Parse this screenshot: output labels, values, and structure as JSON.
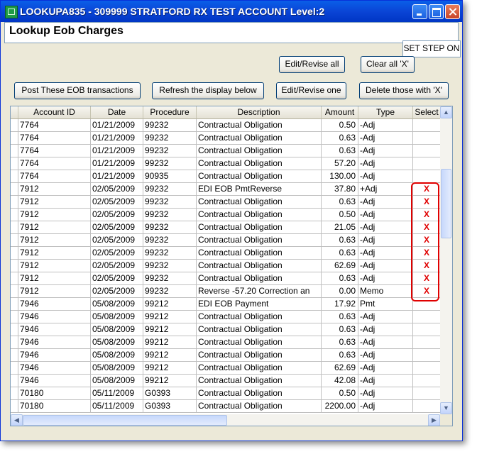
{
  "window": {
    "title": "LOOKUPA835  -  309999 STRATFORD RX TEST ACCOUNT Level:2"
  },
  "header": {
    "title": "Lookup Eob Charges"
  },
  "buttons": {
    "set_step_on": "SET STEP ON",
    "edit_revise_all": "Edit/Revise all",
    "clear_all_x": "Clear all 'X'",
    "post_eob": "Post These EOB transactions",
    "refresh": "Refresh the display below",
    "edit_revise_one": "Edit/Revise one",
    "delete_x": "Delete those with 'X'"
  },
  "table": {
    "columns": [
      "Account ID",
      "Date",
      "Procedure",
      "Description",
      "Amount",
      "Type",
      "Select"
    ],
    "rows": [
      [
        "7764",
        "01/21/2009",
        "99232",
        "Contractual Obligation",
        "0.50",
        "-Adj",
        ""
      ],
      [
        "7764",
        "01/21/2009",
        "99232",
        "Contractual Obligation",
        "0.63",
        "-Adj",
        ""
      ],
      [
        "7764",
        "01/21/2009",
        "99232",
        "Contractual Obligation",
        "0.63",
        "-Adj",
        ""
      ],
      [
        "7764",
        "01/21/2009",
        "99232",
        "Contractual Obligation",
        "57.20",
        "-Adj",
        ""
      ],
      [
        "7764",
        "01/21/2009",
        "90935",
        "Contractual Obligation",
        "130.00",
        "-Adj",
        ""
      ],
      [
        "7912",
        "02/05/2009",
        "99232",
        "EDI EOB PmtReverse",
        "37.80",
        "+Adj",
        "X"
      ],
      [
        "7912",
        "02/05/2009",
        "99232",
        "Contractual Obligation",
        "0.63",
        "-Adj",
        "X"
      ],
      [
        "7912",
        "02/05/2009",
        "99232",
        "Contractual Obligation",
        "0.50",
        "-Adj",
        "X"
      ],
      [
        "7912",
        "02/05/2009",
        "99232",
        "Contractual Obligation",
        "21.05",
        "-Adj",
        "X"
      ],
      [
        "7912",
        "02/05/2009",
        "99232",
        "Contractual Obligation",
        "0.63",
        "-Adj",
        "X"
      ],
      [
        "7912",
        "02/05/2009",
        "99232",
        "Contractual Obligation",
        "0.63",
        "-Adj",
        "X"
      ],
      [
        "7912",
        "02/05/2009",
        "99232",
        "Contractual Obligation",
        "62.69",
        "-Adj",
        "X"
      ],
      [
        "7912",
        "02/05/2009",
        "99232",
        "Contractual Obligation",
        "0.63",
        "-Adj",
        "X"
      ],
      [
        "7912",
        "02/05/2009",
        "99232",
        "Reverse -57.20 Correction an",
        "0.00",
        "Memo",
        "X"
      ],
      [
        "7946",
        "05/08/2009",
        "99212",
        "EDI EOB Payment",
        "17.92",
        "Pmt",
        ""
      ],
      [
        "7946",
        "05/08/2009",
        "99212",
        "Contractual Obligation",
        "0.63",
        "-Adj",
        ""
      ],
      [
        "7946",
        "05/08/2009",
        "99212",
        "Contractual Obligation",
        "0.63",
        "-Adj",
        ""
      ],
      [
        "7946",
        "05/08/2009",
        "99212",
        "Contractual Obligation",
        "0.63",
        "-Adj",
        ""
      ],
      [
        "7946",
        "05/08/2009",
        "99212",
        "Contractual Obligation",
        "0.63",
        "-Adj",
        ""
      ],
      [
        "7946",
        "05/08/2009",
        "99212",
        "Contractual Obligation",
        "62.69",
        "-Adj",
        ""
      ],
      [
        "7946",
        "05/08/2009",
        "99212",
        "Contractual Obligation",
        "42.08",
        "-Adj",
        ""
      ],
      [
        "70180",
        "05/11/2009",
        "G0393",
        "Contractual Obligation",
        "0.50",
        "-Adj",
        ""
      ],
      [
        "70180",
        "05/11/2009",
        "G0393",
        "Contractual Obligation",
        "2200.00",
        "-Adj",
        ""
      ]
    ]
  },
  "colors": {
    "titlebar": "#0a45d6",
    "select_mark": "#e00000",
    "highlight_box": "#e00000"
  },
  "icons": [
    "app-icon",
    "minimize-icon",
    "maximize-icon",
    "close-icon",
    "scroll-up-icon",
    "scroll-down-icon",
    "scroll-left-icon",
    "scroll-right-icon"
  ]
}
